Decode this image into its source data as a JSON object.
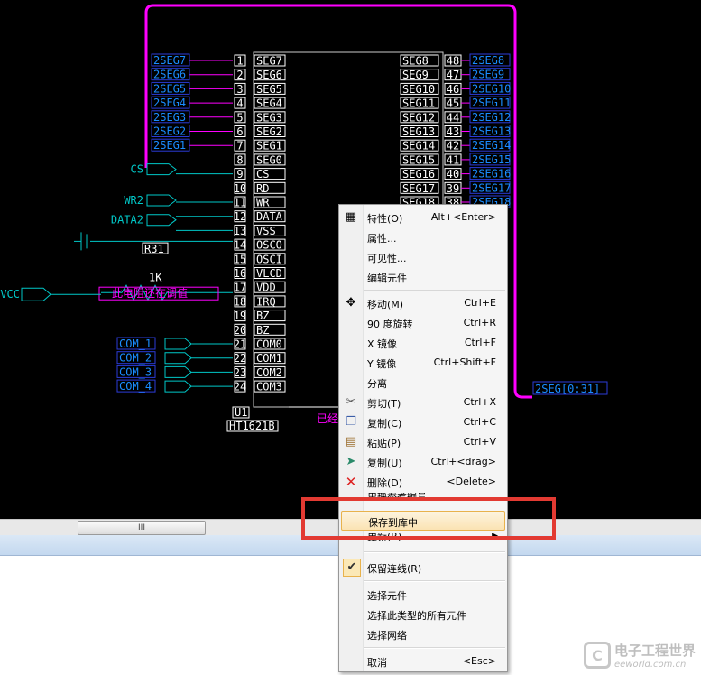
{
  "schematic": {
    "left_pins": [
      {
        "num": "1",
        "name": "SEG7",
        "net": "2SEG7"
      },
      {
        "num": "2",
        "name": "SEG6",
        "net": "2SEG6"
      },
      {
        "num": "3",
        "name": "SEG5",
        "net": "2SEG5"
      },
      {
        "num": "4",
        "name": "SEG4",
        "net": "2SEG4"
      },
      {
        "num": "5",
        "name": "SEG3",
        "net": "2SEG3"
      },
      {
        "num": "6",
        "name": "SEG2",
        "net": "2SEG2"
      },
      {
        "num": "7",
        "name": "SEG1",
        "net": "2SEG1"
      },
      {
        "num": "8",
        "name": "SEG0",
        "net": ""
      },
      {
        "num": "9",
        "name": "CS",
        "net": ""
      },
      {
        "num": "10",
        "name": "RD",
        "net": ""
      },
      {
        "num": "11",
        "name": "WR",
        "net": ""
      },
      {
        "num": "12",
        "name": "DATA",
        "net": ""
      },
      {
        "num": "13",
        "name": "VSS",
        "net": ""
      },
      {
        "num": "14",
        "name": "OSCO",
        "net": ""
      },
      {
        "num": "15",
        "name": "OSCI",
        "net": ""
      },
      {
        "num": "16",
        "name": "VLCD",
        "net": ""
      },
      {
        "num": "17",
        "name": "VDD",
        "net": ""
      },
      {
        "num": "18",
        "name": "IRQ",
        "net": ""
      },
      {
        "num": "19",
        "name": "BZ",
        "net": ""
      },
      {
        "num": "20",
        "name": "BZ",
        "net": ""
      },
      {
        "num": "21",
        "name": "COM0",
        "net": "COM_1"
      },
      {
        "num": "22",
        "name": "COM1",
        "net": "COM_2"
      },
      {
        "num": "23",
        "name": "COM2",
        "net": "COM_3"
      },
      {
        "num": "24",
        "name": "COM3",
        "net": "COM_4"
      }
    ],
    "right_pins": [
      {
        "num": "48",
        "name": "SEG8",
        "net": "2SEG8"
      },
      {
        "num": "47",
        "name": "SEG9",
        "net": "2SEG9"
      },
      {
        "num": "46",
        "name": "SEG10",
        "net": "2SEG10"
      },
      {
        "num": "45",
        "name": "SEG11",
        "net": "2SEG11"
      },
      {
        "num": "44",
        "name": "SEG12",
        "net": "2SEG12"
      },
      {
        "num": "43",
        "name": "SEG13",
        "net": "2SEG13"
      },
      {
        "num": "42",
        "name": "SEG14",
        "net": "2SEG14"
      },
      {
        "num": "41",
        "name": "SEG15",
        "net": "2SEG15"
      },
      {
        "num": "40",
        "name": "SEG16",
        "net": "2SEG16"
      },
      {
        "num": "39",
        "name": "SEG17",
        "net": "2SEG17"
      },
      {
        "num": "38",
        "name": "SEG18",
        "net": "2SEG18"
      }
    ],
    "ports": {
      "cs": "CS",
      "wr": "WR2",
      "data": "DATA2",
      "vcc": "VCC"
    },
    "resistor_ref": "R31",
    "resistor_value": "1K",
    "note": "此电阻还在调值",
    "note_partial": "已经",
    "bus_label": "2SEG[0:31]",
    "designator": "U1",
    "part_name": "HT1621B"
  },
  "scrollbar": {
    "grip": "III"
  },
  "context_menu": {
    "items": [
      {
        "id": "properties",
        "icon": "properties-icon",
        "label": "特性(O)",
        "shortcut": "Alt+<Enter>"
      },
      {
        "id": "attributes",
        "label": "属性...",
        "shortcut": ""
      },
      {
        "id": "visibility",
        "label": "可见性...",
        "shortcut": ""
      },
      {
        "id": "edit-part",
        "label": "编辑元件",
        "shortcut": ""
      },
      {
        "id": "move",
        "icon": "move-icon",
        "label": "移动(M)",
        "shortcut": "Ctrl+E"
      },
      {
        "id": "rotate",
        "label": "90 度旋转",
        "shortcut": "Ctrl+R"
      },
      {
        "id": "mirror-x",
        "label": "X 镜像",
        "shortcut": "Ctrl+F"
      },
      {
        "id": "mirror-y",
        "label": "Y 镜像",
        "shortcut": "Ctrl+Shift+F"
      },
      {
        "id": "separate",
        "label": "分离",
        "shortcut": ""
      },
      {
        "id": "cut",
        "icon": "cut-icon",
        "label": "剪切(T)",
        "shortcut": "Ctrl+X"
      },
      {
        "id": "copy",
        "icon": "copy-icon",
        "label": "复制(C)",
        "shortcut": "Ctrl+C"
      },
      {
        "id": "paste",
        "icon": "paste-icon",
        "label": "粘贴(P)",
        "shortcut": "Ctrl+V"
      },
      {
        "id": "duplicate",
        "icon": "duplicate-icon",
        "label": "复制(U)",
        "shortcut": "Ctrl+<drag>"
      },
      {
        "id": "delete",
        "icon": "delete-icon",
        "label": "删除(D)",
        "shortcut": "<Delete>"
      },
      {
        "id": "change-ref",
        "label": "更换参考编号",
        "shortcut": ""
      },
      {
        "id": "save-to-library",
        "label": "保存到库中",
        "shortcut": ""
      },
      {
        "id": "update",
        "label": "更新(R)",
        "shortcut": ""
      },
      {
        "id": "keep-wires",
        "label": "保留连线(R)",
        "shortcut": ""
      },
      {
        "id": "select-part",
        "label": "选择元件",
        "shortcut": ""
      },
      {
        "id": "select-same-type",
        "label": "选择此类型的所有元件",
        "shortcut": ""
      },
      {
        "id": "select-net",
        "label": "选择网络",
        "shortcut": ""
      },
      {
        "id": "cancel",
        "label": "取消",
        "shortcut": "<Esc>"
      }
    ]
  },
  "watermark": {
    "cn": "电子工程世界",
    "en": "eeworld.com.cn",
    "logo": "C"
  },
  "colors": {
    "wire": "#ff00ff",
    "net_text": "#1a8cff",
    "part_text": "#ffffff",
    "pin_box": "#ffffff",
    "port": "#00c8c8",
    "highlight": "#fbe3b3",
    "red_frame": "#e23a32"
  }
}
